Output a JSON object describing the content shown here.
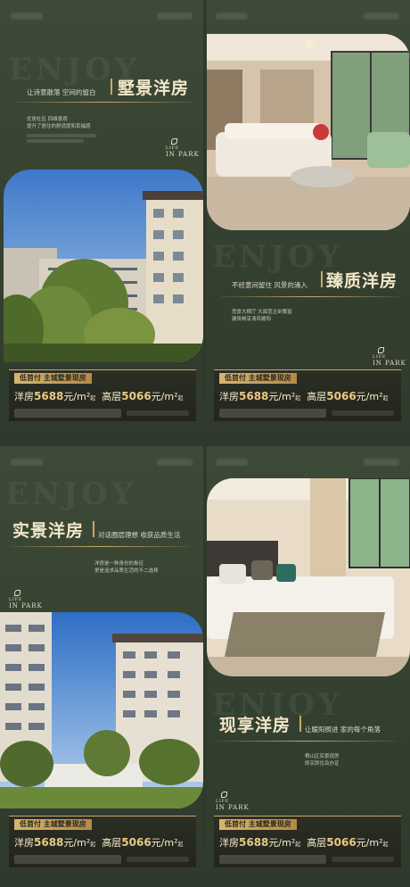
{
  "posters": [
    {
      "title": "墅景洋房",
      "slogan": "让诗意散落 空间的留白",
      "desc": [
        "优居社区 四维景观",
        "提升了居住的舒适度和幸福感"
      ],
      "brand": {
        "line1": "LIFE",
        "line2": "IN PARK"
      },
      "ghost": "ENJOY",
      "price": {
        "tag": "低首付 主城墅景现房",
        "label1": "洋房",
        "value1": "5688",
        "unit1": "元/m²",
        "suffix1": "起",
        "label2": "高层",
        "value2": "5066",
        "unit2": "元/m²",
        "suffix2": "起"
      }
    },
    {
      "title": "臻质洋房",
      "slogan": "不经意间留住 风景的涌入",
      "desc": [
        "宽景大横厅 大面宽主卧飘窗",
        "建筑畅享清风暖阳"
      ],
      "brand": {
        "line1": "LIFE",
        "line2": "IN PARK"
      },
      "ghost": "ENJOY",
      "price": {
        "tag": "低首付 主城墅景现房",
        "label1": "洋房",
        "value1": "5688",
        "unit1": "元/m²",
        "suffix1": "起",
        "label2": "高层",
        "value2": "5066",
        "unit2": "元/m²",
        "suffix2": "起"
      }
    },
    {
      "title": "实景洋房",
      "slogan": "对话圈层理想 收获品质生活",
      "desc": [
        "洋房是一种身份的象征",
        "更是追求品质生活的不二选择"
      ],
      "brand": {
        "line1": "LIFE",
        "line2": "IN PARK"
      },
      "ghost": "ENJOY",
      "price": {
        "tag": "低首付 主城墅景现房",
        "label1": "洋房",
        "value1": "5688",
        "unit1": "元/m²",
        "suffix1": "起",
        "label2": "高层",
        "value2": "5066",
        "unit2": "元/m²",
        "suffix2": "起"
      }
    },
    {
      "title": "现享洋房",
      "slogan": "让暖阳照进 家的每个角落",
      "desc": [
        "桐山区实景现房",
        "即买即住及办证"
      ],
      "brand": {
        "line1": "LIFE",
        "line2": "IN PARK"
      },
      "ghost": "ENJOY",
      "price": {
        "tag": "低首付 主城墅景现房",
        "label1": "洋房",
        "value1": "5688",
        "unit1": "元/m²",
        "suffix1": "起",
        "label2": "高层",
        "value2": "5066",
        "unit2": "元/m²",
        "suffix2": "起"
      }
    }
  ],
  "colors": {
    "bg": "#3d4a37",
    "gold": "#c9a86a",
    "title": "#f2e6c9"
  }
}
